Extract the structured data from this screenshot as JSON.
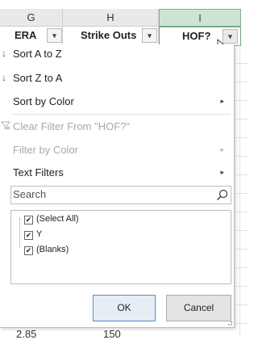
{
  "columns": {
    "g": {
      "letter": "G",
      "header": "ERA"
    },
    "h": {
      "letter": "H",
      "header": "Strike Outs"
    },
    "i": {
      "letter": "I",
      "header": "HOF?"
    }
  },
  "dropdown_glyph": "▾",
  "menu": {
    "sort_az": "Sort A to Z",
    "sort_za": "Sort Z to A",
    "sort_by_color": "Sort by Color",
    "clear_filter": "Clear Filter From \"HOF?\"",
    "filter_by_color": "Filter by Color",
    "text_filters": "Text Filters",
    "submenu_arrow": "▸"
  },
  "search": {
    "placeholder": "Search"
  },
  "filter_values": [
    {
      "label": "(Select All)",
      "checked": true
    },
    {
      "label": "Y",
      "checked": true
    },
    {
      "label": "(Blanks)",
      "checked": true
    }
  ],
  "checkmark": "✔",
  "buttons": {
    "ok": "OK",
    "cancel": "Cancel"
  },
  "bottom_row": {
    "era": "2.85",
    "strike_outs": "150"
  }
}
